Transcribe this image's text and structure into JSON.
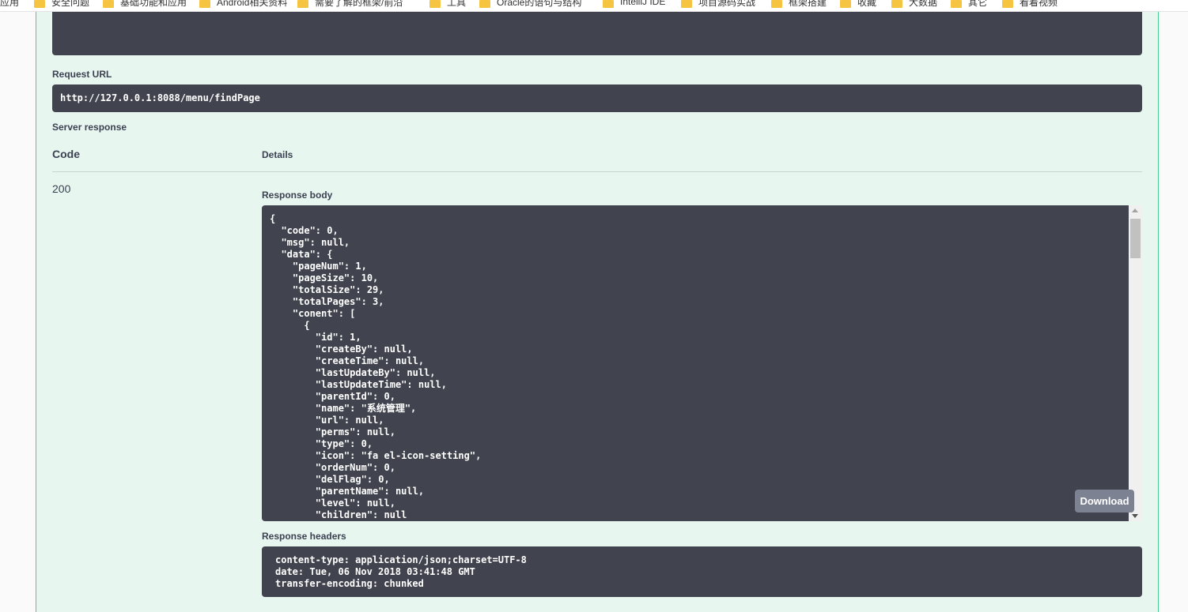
{
  "bookmarks": [
    "应用",
    "安全问题",
    "基础功能和应用",
    "Android相关资料",
    "需要了解的框架/前沿",
    "工具",
    "Oracle的语句与结构",
    "IntelliJ IDE",
    "项目源码实战",
    "框架搭建",
    "收藏",
    "大数据",
    "其它",
    "看着视频"
  ],
  "request_url": {
    "label": "Request URL",
    "value": "http://127.0.0.1:8088/menu/findPage"
  },
  "server_response": {
    "label": "Server response",
    "code_header": "Code",
    "details_header": "Details",
    "code": "200",
    "response_body_label": "Response body",
    "response_body": "{\n  \"code\": 0,\n  \"msg\": null,\n  \"data\": {\n    \"pageNum\": 1,\n    \"pageSize\": 10,\n    \"totalSize\": 29,\n    \"totalPages\": 3,\n    \"conent\": [\n      {\n        \"id\": 1,\n        \"createBy\": null,\n        \"createTime\": null,\n        \"lastUpdateBy\": null,\n        \"lastUpdateTime\": null,\n        \"parentId\": 0,\n        \"name\": \"系统管理\",\n        \"url\": null,\n        \"perms\": null,\n        \"type\": 0,\n        \"icon\": \"fa el-icon-setting\",\n        \"orderNum\": 0,\n        \"delFlag\": 0,\n        \"parentName\": null,\n        \"level\": null,\n        \"children\": null",
    "download_label": "Download",
    "response_headers_label": "Response headers",
    "response_headers": "content-type: application/json;charset=UTF-8\ndate: Tue, 06 Nov 2018 03:41:48 GMT\ntransfer-encoding: chunked"
  },
  "colors": {
    "block_bg": "#e8f6f0",
    "block_border": "#49cc90",
    "code_bg": "#41444e",
    "download_bg": "#7d8293"
  }
}
